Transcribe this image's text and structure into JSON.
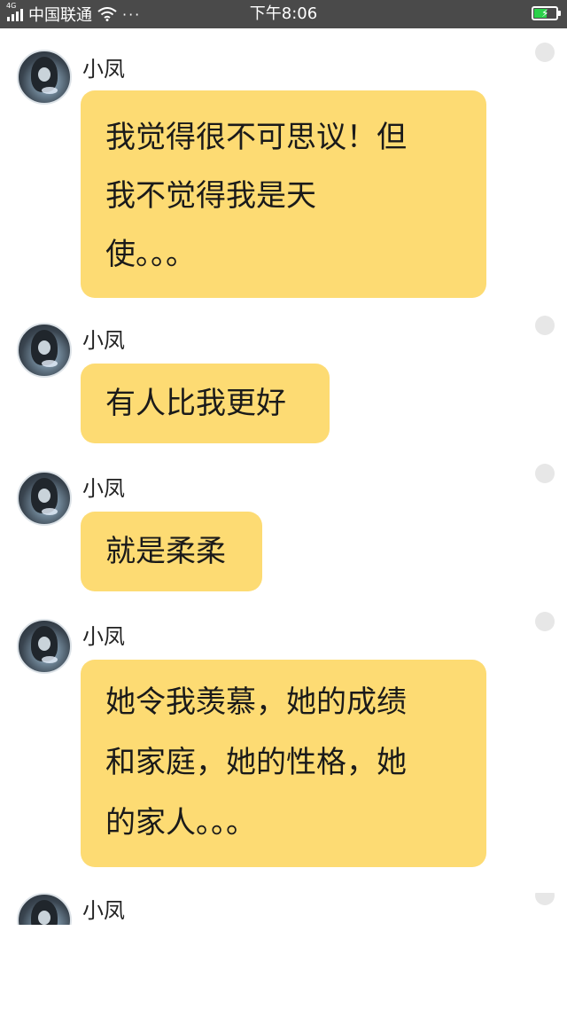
{
  "status_bar": {
    "network_type": "4G",
    "carrier": "中国联通",
    "more": "···",
    "time": "下午8:06"
  },
  "messages": [
    {
      "sender": "小凤",
      "text": "我觉得很不可思议！但\n我不觉得我是天\n使。。。"
    },
    {
      "sender": "小凤",
      "text": "有人比我更好"
    },
    {
      "sender": "小凤",
      "text": "就是柔柔"
    },
    {
      "sender": "小凤",
      "text": "她令我羡慕，她的成绩\n和家庭，她的性格，她\n的家人。。。"
    },
    {
      "sender": "小凤",
      "text": ""
    }
  ]
}
